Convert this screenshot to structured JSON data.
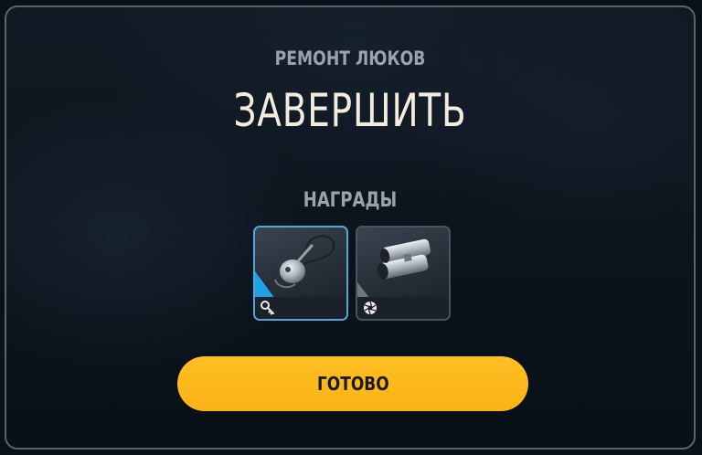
{
  "dialog": {
    "subtitle": "РЕМОНТ ЛЮКОВ",
    "title": "ЗАВЕРШИТЬ",
    "rewards_label": "НАГРАДЫ",
    "done_label": "ГОТОВО"
  },
  "rewards": [
    {
      "item_icon": "key-fob-icon",
      "type_icon": "key-icon",
      "selected": true
    },
    {
      "item_icon": "binoculars-icon",
      "type_icon": "aperture-icon",
      "selected": false
    }
  ],
  "colors": {
    "button": "#ffbb1e",
    "selected_border": "#4fa8d8",
    "selected_corner": "#1fa3e8",
    "title_text": "#f4ecde",
    "label_text": "#9aa3ad"
  }
}
